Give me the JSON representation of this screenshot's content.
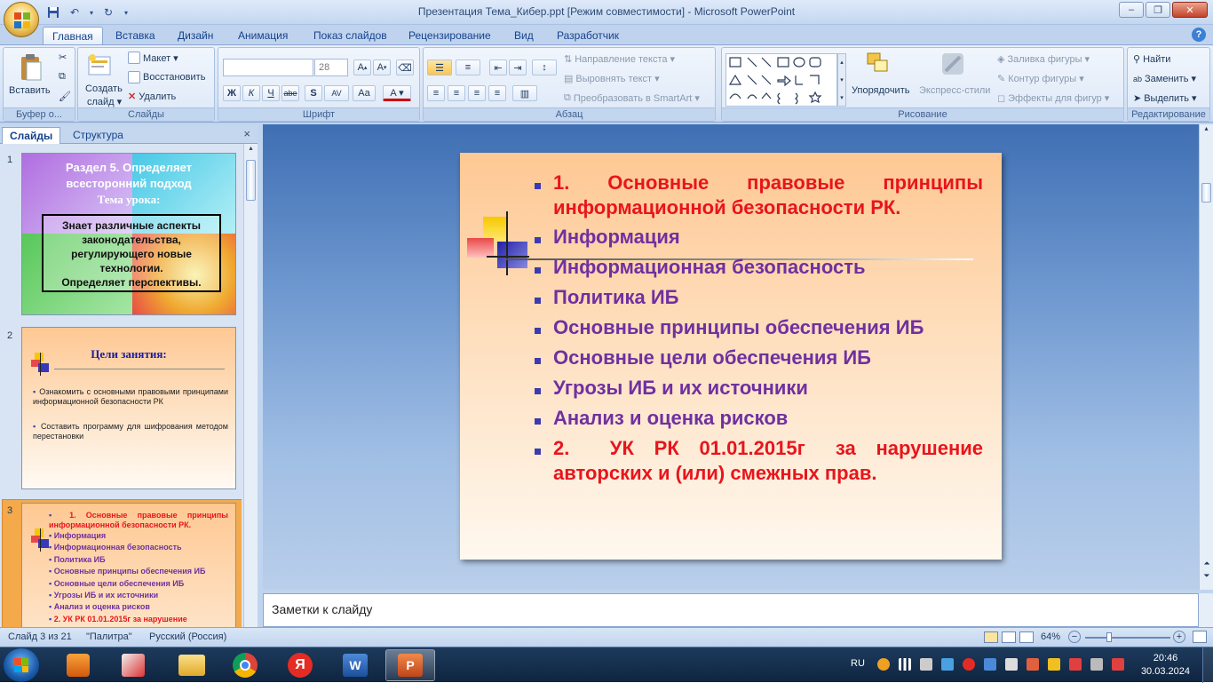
{
  "window": {
    "title": "Презентация Тема_Кибер.ppt [Режим совместимости] - Microsoft PowerPoint",
    "minimize": "–",
    "restore": "❐",
    "close": "✕"
  },
  "tabs": [
    "Главная",
    "Вставка",
    "Дизайн",
    "Анимация",
    "Показ слайдов",
    "Рецензирование",
    "Вид",
    "Разработчик"
  ],
  "ribbon": {
    "clipboard": {
      "label": "Буфер о...",
      "paste": "Вставить"
    },
    "slides": {
      "label": "Слайды",
      "new_slide_1": "Создать",
      "new_slide_2": "слайд ▾",
      "layout": "Макет ▾",
      "reset": "Восстановить",
      "delete": "Удалить"
    },
    "font": {
      "label": "Шрифт",
      "font_name": "",
      "font_size": "28",
      "bold": "Ж",
      "italic": "К",
      "underline": "Ч",
      "strike": "abe",
      "shadow": "S",
      "spacing": "AV",
      "case": "Aa"
    },
    "paragraph": {
      "label": "Абзац",
      "text_direction": "Направление текста ▾",
      "align_text": "Выровнять текст ▾",
      "smartart": "Преобразовать в SmartArt ▾"
    },
    "drawing": {
      "label": "Рисование",
      "arrange": "Упорядочить",
      "quick_styles": "Экспресс-стили",
      "shape_fill": "Заливка фигуры ▾",
      "shape_outline": "Контур фигуры ▾",
      "shape_effects": "Эффекты для фигур ▾"
    },
    "editing": {
      "label": "Редактирование",
      "find": "Найти",
      "replace": "Заменить ▾",
      "select": "Выделить ▾"
    }
  },
  "left_pane": {
    "tab_slides": "Слайды",
    "tab_outline": "Структура",
    "close": "×",
    "slides": [
      {
        "num": "1",
        "title_1": "Раздел 5. Определяет",
        "title_2": "всесторонний подход",
        "subtitle": "Тема урока:",
        "box_1": "Знает различные  аспекты",
        "box_2": "законодательства,",
        "box_3": "регулирующего  новые",
        "box_4": "технологии.",
        "box_5": "Определяет  перспективы."
      },
      {
        "num": "2",
        "title": "Цели занятия:",
        "item_1": "Ознакомить   с     основными   правовыми принципами информационной безопасности РК",
        "item_2": "Составить    программу    для    шифрования методом перестановки"
      },
      {
        "num": "3",
        "items": [
          "1.   Основные   правовые   принципы информационной безопасности РК.",
          "Информация",
          "Информационная безопасность",
          "Политика ИБ",
          "Основные принципы обеспечения  ИБ",
          "Основные цели обеспечения  ИБ",
          "Угрозы ИБ и их источники",
          "Анализ и оценка рисков",
          "2.    УК РК 01.01.2015г   за нарушение"
        ]
      }
    ]
  },
  "slide": {
    "bullets": [
      {
        "text_1": "1.   Основные   правовые   принципы",
        "text_2": "информационной безопасности РК.",
        "color": "#e8151c"
      },
      {
        "text_1": "Информация",
        "color": "#7030a0"
      },
      {
        "text_1": "Информационная безопасность",
        "color": "#7030a0"
      },
      {
        "text_1": "Политика ИБ",
        "color": "#7030a0"
      },
      {
        "text_1": "Основные принципы обеспечения ИБ",
        "color": "#7030a0"
      },
      {
        "text_1": "Основные цели обеспечения ИБ",
        "color": "#7030a0"
      },
      {
        "text_1": "Угрозы ИБ и их источники",
        "color": "#7030a0"
      },
      {
        "text_1": "Анализ и оценка рисков",
        "color": "#7030a0"
      },
      {
        "text_1": "2.    УК  РК  01.01.2015г   за  нарушение",
        "text_2": "авторских и (или) смежных прав.",
        "color": "#e8151c"
      }
    ]
  },
  "notes": {
    "placeholder": "Заметки к слайду"
  },
  "status": {
    "slide": "Слайд 3 из 21",
    "theme": "\"Палитра\"",
    "language": "Русский (Россия)",
    "zoom": "64%"
  },
  "taskbar": {
    "lang": "RU",
    "time": "20:46",
    "date": "30.03.2024"
  }
}
